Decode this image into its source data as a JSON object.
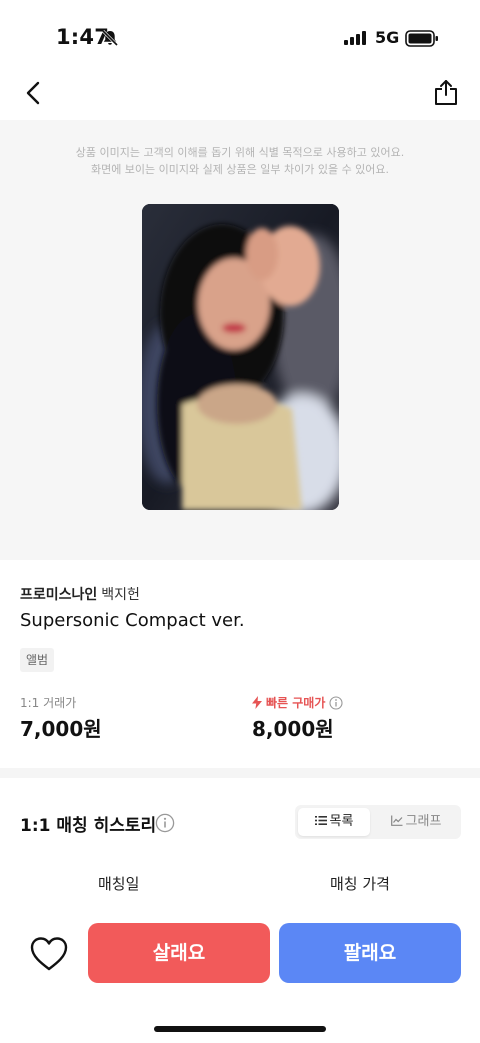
{
  "status_bar": {
    "time": "1:47",
    "network": "5G",
    "icons": [
      "bell-muted-icon",
      "signal-icon",
      "battery-icon"
    ]
  },
  "nav": {
    "icons": [
      "back-icon",
      "share-icon"
    ]
  },
  "image_section": {
    "disclaimer_line1": "상품 이미지는 고객의 이해를 돕기 위해 식별 목적으로 사용하고 있어요.",
    "disclaimer_line2": "화면에 보이는 이미지와 실제 상품은 일부 차이가 있을 수 있어요."
  },
  "product": {
    "brand": "프로미스나인",
    "member": "백지헌",
    "name": "Supersonic Compact ver.",
    "category": "앨범"
  },
  "prices": {
    "trade_label": "1:1 거래가",
    "trade_value": "7,000원",
    "fast_label": "빠른 구매가",
    "fast_value": "8,000원"
  },
  "history": {
    "title": "1:1 매칭 히스토리",
    "toggle_list": "목록",
    "toggle_graph": "그래프",
    "col_date": "매칭일",
    "col_price": "매칭 가격"
  },
  "actions": {
    "buy": "살래요",
    "sell": "팔래요"
  },
  "colors": {
    "buy": "#f25a5a",
    "sell": "#5b87f5",
    "fast_price": "#e65454"
  }
}
